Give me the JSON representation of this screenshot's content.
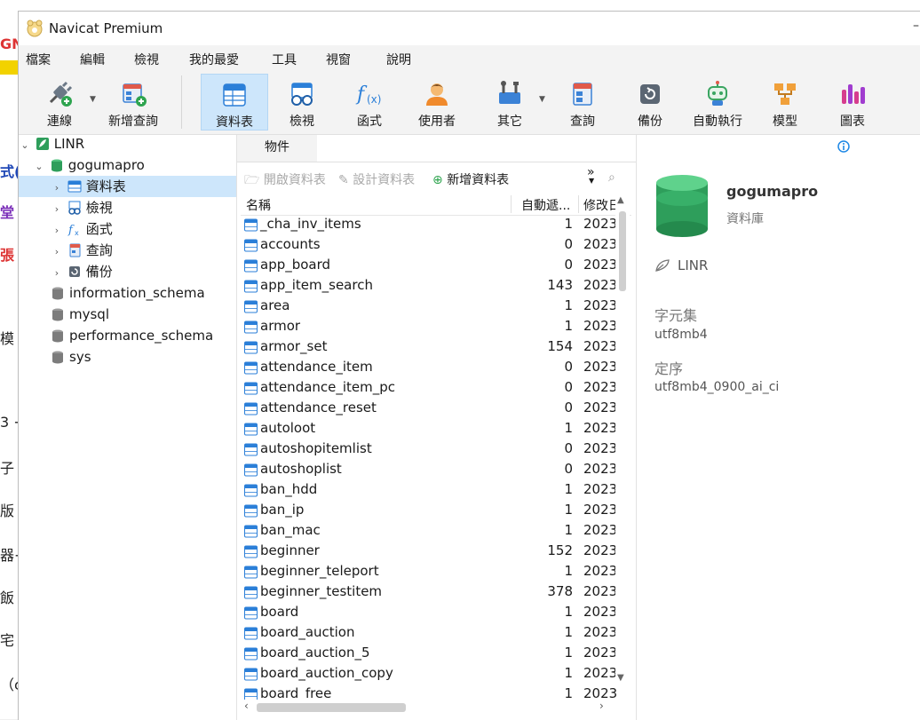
{
  "window": {
    "title": "Navicat Premium"
  },
  "background_fragments": [
    "GN",
    "式(",
    "堂",
    "張",
    "模",
    "3 +",
    "子 j",
    "版",
    "器+",
    "飯",
    "宅",
    "（cl"
  ],
  "menu": [
    "檔案",
    "編輯",
    "檢視",
    "我的最愛",
    "工具",
    "視窗",
    "說明"
  ],
  "toolbar": {
    "connect": "連線",
    "new_query": "新增查詢",
    "tables": "資料表",
    "views": "檢視",
    "functions": "函式",
    "users": "使用者",
    "others": "其它",
    "query": "查詢",
    "backup": "備份",
    "automation": "自動執行",
    "model": "模型",
    "charts": "圖表"
  },
  "tree": {
    "connection": "LINR",
    "database": "gogumapro",
    "children": [
      "資料表",
      "檢視",
      "函式",
      "查詢",
      "備份"
    ],
    "other_databases": [
      "information_schema",
      "mysql",
      "performance_schema",
      "sys"
    ]
  },
  "objects": {
    "tab": "物件",
    "open_table": "開啟資料表",
    "design_table": "設計資料表",
    "new_table": "新增資料表",
    "more": "»",
    "columns": {
      "name": "名稱",
      "auto_inc": "自動遞...",
      "modified": "修改日"
    },
    "rows": [
      {
        "name": "_cha_inv_items",
        "auto_inc": "1",
        "modified": "2023"
      },
      {
        "name": "accounts",
        "auto_inc": "0",
        "modified": "2023"
      },
      {
        "name": "app_board",
        "auto_inc": "0",
        "modified": "2023"
      },
      {
        "name": "app_item_search",
        "auto_inc": "143",
        "modified": "2023"
      },
      {
        "name": "area",
        "auto_inc": "1",
        "modified": "2023"
      },
      {
        "name": "armor",
        "auto_inc": "1",
        "modified": "2023"
      },
      {
        "name": "armor_set",
        "auto_inc": "154",
        "modified": "2023"
      },
      {
        "name": "attendance_item",
        "auto_inc": "0",
        "modified": "2023"
      },
      {
        "name": "attendance_item_pc",
        "auto_inc": "0",
        "modified": "2023"
      },
      {
        "name": "attendance_reset",
        "auto_inc": "0",
        "modified": "2023"
      },
      {
        "name": "autoloot",
        "auto_inc": "1",
        "modified": "2023"
      },
      {
        "name": "autoshopitemlist",
        "auto_inc": "0",
        "modified": "2023"
      },
      {
        "name": "autoshoplist",
        "auto_inc": "0",
        "modified": "2023"
      },
      {
        "name": "ban_hdd",
        "auto_inc": "1",
        "modified": "2023"
      },
      {
        "name": "ban_ip",
        "auto_inc": "1",
        "modified": "2023"
      },
      {
        "name": "ban_mac",
        "auto_inc": "1",
        "modified": "2023"
      },
      {
        "name": "beginner",
        "auto_inc": "152",
        "modified": "2023"
      },
      {
        "name": "beginner_teleport",
        "auto_inc": "1",
        "modified": "2023"
      },
      {
        "name": "beginner_testitem",
        "auto_inc": "378",
        "modified": "2023"
      },
      {
        "name": "board",
        "auto_inc": "1",
        "modified": "2023"
      },
      {
        "name": "board_auction",
        "auto_inc": "1",
        "modified": "2023"
      },
      {
        "name": "board_auction_5",
        "auto_inc": "1",
        "modified": "2023"
      },
      {
        "name": "board_auction_copy",
        "auto_inc": "1",
        "modified": "2023"
      },
      {
        "name": "board_free",
        "auto_inc": "1",
        "modified": "2023"
      }
    ]
  },
  "info": {
    "name": "gogumapro",
    "type": "資料庫",
    "connection": "LINR",
    "charset_label": "字元集",
    "charset": "utf8mb4",
    "collation_label": "定序",
    "collation": "utf8mb4_0900_ai_ci"
  },
  "colors": {
    "selection": "#cde6fb",
    "accent": "#1e88e5",
    "db_green": "#2e9e5b"
  }
}
